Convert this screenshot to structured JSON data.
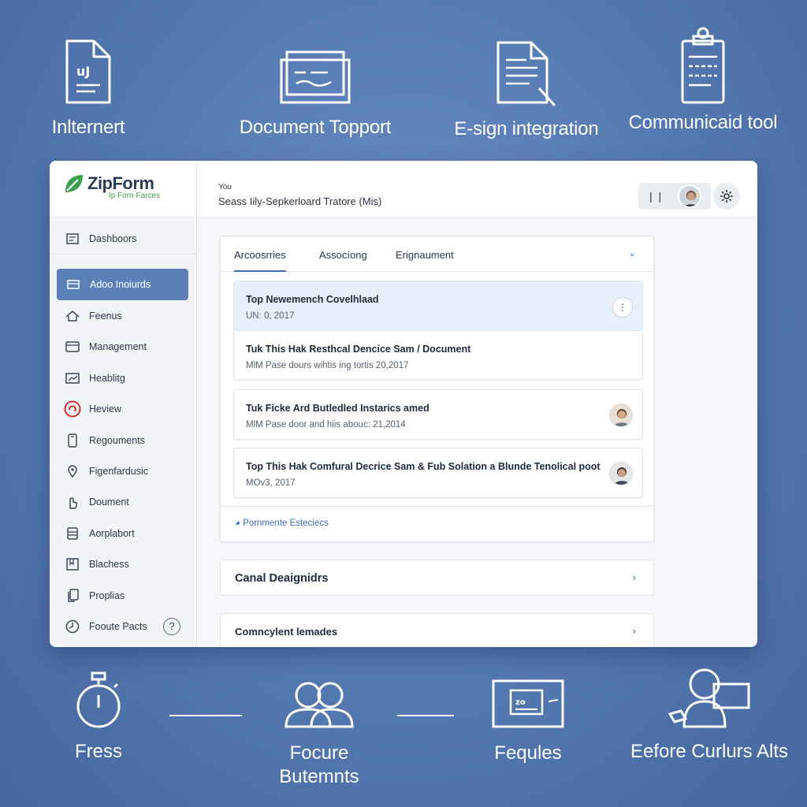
{
  "top_features": [
    {
      "icon": "document-icon",
      "label": "Inlternert"
    },
    {
      "icon": "monitor-icon",
      "label": "Document Topport"
    },
    {
      "icon": "e-sign-icon",
      "label": "E-sign integration"
    },
    {
      "icon": "clipboard-icon",
      "label": "Communicaid tool"
    }
  ],
  "brand": {
    "name": "ZipForm",
    "tagline": "Ip Forn Farces"
  },
  "sidebar": {
    "items": [
      {
        "label": "Dashboors",
        "icon": "dashboard-icon"
      },
      {
        "label": "Adoo Inoiurds",
        "icon": "inbox-icon",
        "active": true
      },
      {
        "label": "Feenus",
        "icon": "home-icon"
      },
      {
        "label": "Management",
        "icon": "folder-icon"
      },
      {
        "label": "Heablitg",
        "icon": "chart-icon"
      },
      {
        "label": "Heview",
        "icon": "review-icon"
      },
      {
        "label": "Regouments",
        "icon": "phone-icon"
      },
      {
        "label": "Figenfardusic",
        "icon": "location-icon"
      },
      {
        "label": "Doument",
        "icon": "hand-icon"
      },
      {
        "label": "Aorplabort",
        "icon": "list-icon"
      },
      {
        "label": "Blachess",
        "icon": "bookmark-icon"
      },
      {
        "label": "Proplias",
        "icon": "copy-icon"
      },
      {
        "label": "Fooute Pacts",
        "icon": "clock-icon",
        "help": "?"
      }
    ]
  },
  "header": {
    "eyebrow": "You",
    "title": "Seass Iily-Sepkerloard Tratore (Mis)"
  },
  "tabs": [
    {
      "label": "Arcoosrries",
      "active": true
    },
    {
      "label": "Assocíong"
    },
    {
      "label": "Erignaument"
    }
  ],
  "cards": [
    {
      "title": "Top Newemench Covelhlaad",
      "sub": "UN: 0, 2017",
      "action": "more-button",
      "more_label": "⋮",
      "highlight": true
    },
    {
      "title": "Tuk This Hak Resthcal Dencice Sam / Document",
      "sub": "MlM Pase dours wihtis ing tortis 20,2017"
    },
    {
      "title": "Tuk Ficke Ard Butledled Instarics amed",
      "sub": "MlM Pase door and hiis abouc: 21,2014",
      "avatar": true
    },
    {
      "title": "Top This Hak Comfural Decrice Sam & Fub Solation a Blunde Tenolical poot",
      "sub": "MOv3, 2017",
      "avatar": true
    }
  ],
  "panel_footer": {
    "link": "Pornmente Esteciecs"
  },
  "rows": [
    {
      "label": "Canal Deaignidrs"
    },
    {
      "label": "Comncylent lemades"
    }
  ],
  "bottom_features": [
    {
      "icon": "stopwatch-icon",
      "label": "Fress"
    },
    {
      "icon": "users-icon",
      "label": "Focure\nButemnts"
    },
    {
      "icon": "screen-icon",
      "label": "Fequles"
    },
    {
      "icon": "person-laptop-icon",
      "label": "Eefore Curlurs Alts"
    }
  ],
  "colors": {
    "background": "#5478b0",
    "accent": "#3d6fb3",
    "active_nav": "#5c81b8",
    "highlight": "#e7f1fb",
    "brand_green": "#3aa14a"
  }
}
